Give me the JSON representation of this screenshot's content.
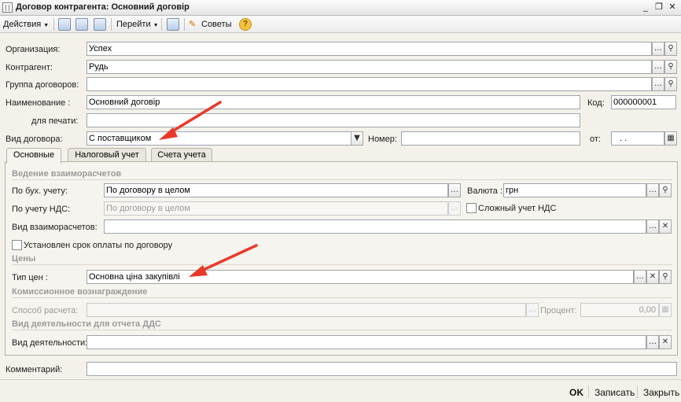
{
  "window": {
    "title": "Договор контрагента: Основний договір"
  },
  "toolbar": {
    "actions_label": "Действия",
    "goto_label": "Перейти",
    "tips_label": "Советы"
  },
  "form": {
    "org": {
      "label": "Организация:",
      "value": "Успех"
    },
    "counterparty": {
      "label": "Контрагент:",
      "value": "Рудь"
    },
    "contract_group": {
      "label": "Группа договоров:",
      "value": ""
    },
    "name": {
      "label": "Наименование :",
      "value": "Основний договір"
    },
    "code": {
      "label": "Код:",
      "value": "000000001"
    },
    "print_name": {
      "label": "для печати:",
      "value": ""
    },
    "contract_type": {
      "label": "Вид договора:",
      "value": "С поставщиком"
    },
    "number": {
      "label": "Номер:",
      "value": ""
    },
    "date": {
      "label": "от:",
      "value": ". ."
    },
    "comment": {
      "label": "Комментарий:",
      "value": ""
    }
  },
  "tabs": [
    {
      "label": "Основные",
      "active": true
    },
    {
      "label": "Налоговый учет",
      "active": false
    },
    {
      "label": "Счета учета",
      "active": false
    }
  ],
  "main_tab": {
    "settlements_header": "Ведение взаиморасчетов",
    "by_accounting": {
      "label": "По бух. учету:",
      "value": "По договору в целом"
    },
    "currency": {
      "label": "Валюта :",
      "value": "грн"
    },
    "by_vat": {
      "label": "По учету НДС:",
      "value": "По договору в целом"
    },
    "complex_vat": {
      "label": "Сложный  учет НДС",
      "checked": false
    },
    "settlement_type": {
      "label": "Вид взаиморасчетов:",
      "value": ""
    },
    "payment_term": {
      "label": "Установлен срок оплаты по договору",
      "checked": false
    },
    "prices_header": "Цены",
    "price_type": {
      "label": "Тип цен :",
      "value": "Основна ціна закупівлі"
    },
    "commission_header": "Комиссионное вознаграждение",
    "calc_method": {
      "label": "Способ расчета:",
      "value": ""
    },
    "percent": {
      "label": "Процент:",
      "value": "0,00"
    },
    "activity_header": "Вид деятельности для отчета ДДС",
    "activity": {
      "label": "Вид деятельности:",
      "value": ""
    }
  },
  "footer": {
    "ok_label": "OK",
    "save_label": "Записать",
    "close_label": "Закрыть"
  },
  "colors": {
    "accent_arrow": "#e8392b",
    "disabled_text": "#9a9a9a"
  }
}
